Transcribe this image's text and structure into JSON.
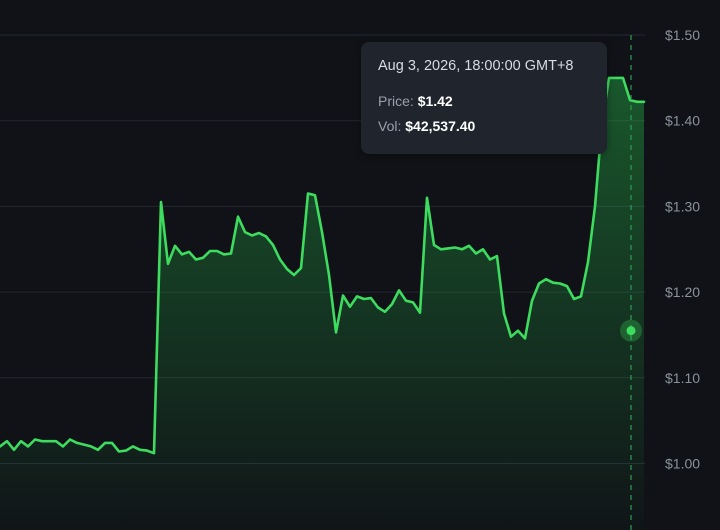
{
  "colors": {
    "background": "#101217",
    "line": "#3ddc5f",
    "grid": "#222832",
    "crosshair": "#2f9e55",
    "tooltip_bg": "#1f242d"
  },
  "tooltip": {
    "date": "Aug 3, 2026, 18:00:00 GMT+8",
    "price_label": "Price:",
    "price_value": "$1.42",
    "vol_label": "Vol:",
    "vol_value": "$42,537.40"
  },
  "chart_data": {
    "type": "area",
    "title": "",
    "xlabel": "",
    "ylabel": "",
    "ylim": [
      0.94,
      1.5
    ],
    "y_axis_position": "right",
    "y_ticks": [
      1.0,
      1.1,
      1.2,
      1.3,
      1.4,
      1.5
    ],
    "y_tick_labels": [
      "$1.00",
      "$1.10",
      "$1.20",
      "$1.30",
      "$1.40",
      "$1.50"
    ],
    "grid": true,
    "highlighted_index": 74,
    "series": [
      {
        "values": [
          1.02,
          1.026,
          1.016,
          1.026,
          1.02,
          1.028,
          1.026,
          1.026,
          1.026,
          1.02,
          1.028,
          1.024,
          1.022,
          1.02,
          1.016,
          1.024,
          1.024,
          1.014,
          1.015,
          1.02,
          1.016,
          1.015,
          1.012,
          1.305,
          1.233,
          1.254,
          1.244,
          1.247,
          1.238,
          1.24,
          1.248,
          1.248,
          1.244,
          1.245,
          1.288,
          1.27,
          1.266,
          1.269,
          1.265,
          1.255,
          1.238,
          1.227,
          1.22,
          1.228,
          1.315,
          1.313,
          1.27,
          1.22,
          1.153,
          1.196,
          1.183,
          1.195,
          1.192,
          1.193,
          1.182,
          1.177,
          1.186,
          1.202,
          1.19,
          1.188,
          1.176,
          1.31,
          1.255,
          1.25,
          1.251,
          1.252,
          1.25,
          1.254,
          1.245,
          1.25,
          1.238,
          1.242,
          1.175,
          1.148,
          1.155,
          1.146,
          1.19,
          1.21,
          1.215,
          1.211,
          1.21,
          1.207,
          1.192,
          1.195,
          1.235,
          1.3,
          1.398,
          1.45,
          1.45,
          1.45,
          1.424,
          1.422,
          1.422
        ]
      }
    ]
  }
}
